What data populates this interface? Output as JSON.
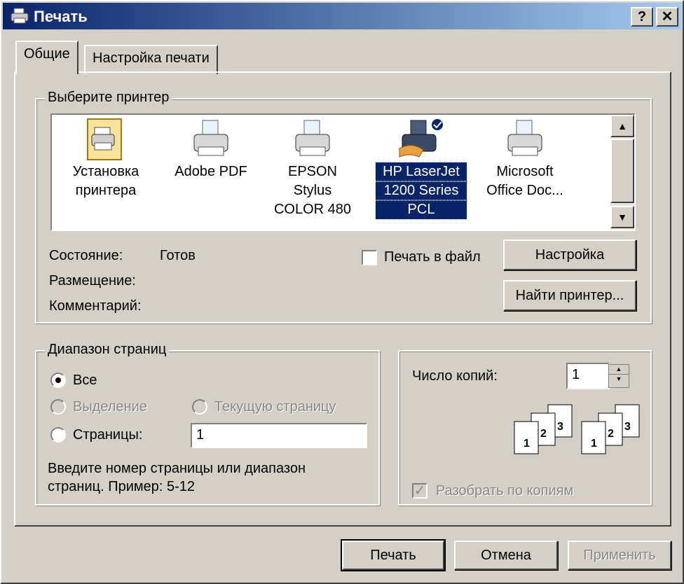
{
  "window": {
    "title": "Печать",
    "help_label": "?",
    "close_label": "✕"
  },
  "tabs": [
    {
      "label": "Общие"
    },
    {
      "label": "Настройка печати"
    }
  ],
  "printer_group": {
    "legend": "Выберите принтер",
    "printers": [
      {
        "line1": "Установка",
        "line2": "принтера",
        "line3": "",
        "icon": "add-printer-icon"
      },
      {
        "line1": "Adobe PDF",
        "line2": "",
        "line3": "",
        "icon": "printer-icon"
      },
      {
        "line1": "EPSON Stylus",
        "line2": "COLOR 480",
        "line3": "",
        "icon": "printer-icon"
      },
      {
        "line1": "HP LaserJet",
        "line2": "1200 Series",
        "line3": "PCL",
        "icon": "shared-default-printer-icon",
        "selected": true
      },
      {
        "line1": "Microsoft",
        "line2": "Office Doc...",
        "line3": "",
        "icon": "printer-icon"
      }
    ],
    "status_label": "Состояние:",
    "status_value": "Готов",
    "location_label": "Размещение:",
    "comment_label": "Комментарий:",
    "print_to_file": {
      "label": "Печать в файл",
      "checked": false
    },
    "setup_button": "Настройка",
    "find_printer_button": "Найти принтер..."
  },
  "page_range": {
    "legend": "Диапазон страниц",
    "all": "Все",
    "selection": "Выделение",
    "current_page": "Текущую страницу",
    "pages": "Страницы:",
    "pages_value": "1",
    "hint_line1": "Введите номер страницы или диапазон",
    "hint_line2": "страниц.  Пример: 5-12"
  },
  "copies": {
    "label": "Число копий:",
    "value": "1",
    "collate_label": "Разобрать по копиям",
    "collate_checked": true,
    "pages_a": [
      "1",
      "2",
      "3"
    ],
    "pages_b": [
      "1",
      "2",
      "3"
    ]
  },
  "buttons": {
    "print": "Печать",
    "cancel": "Отмена",
    "apply": "Применить"
  },
  "colors": {
    "title_start": "#0a246a",
    "title_end": "#a6caf0",
    "face": "#d4d0c8",
    "selection": "#0a246a"
  }
}
